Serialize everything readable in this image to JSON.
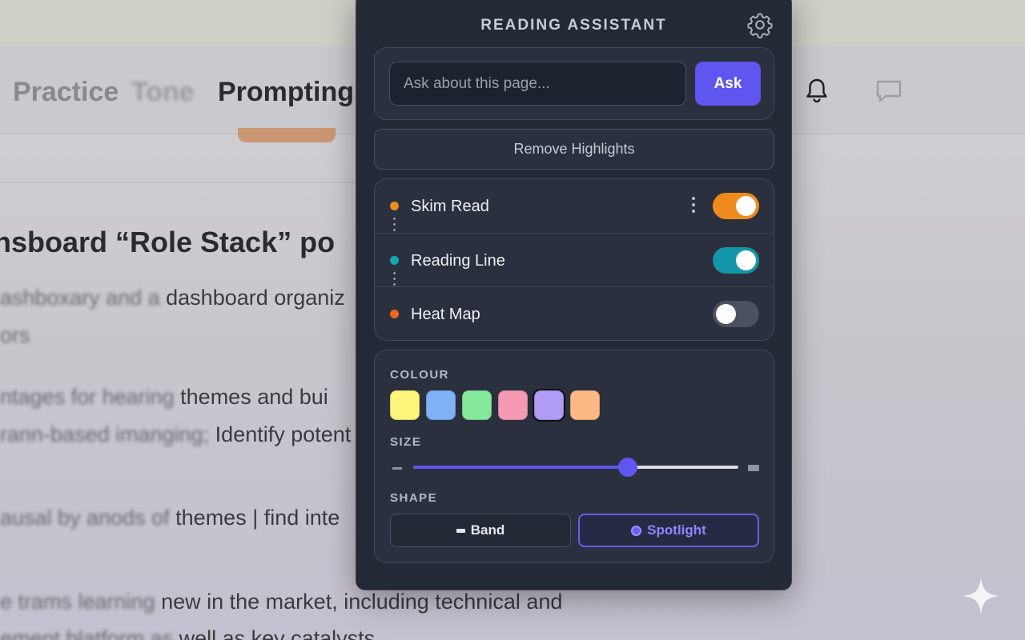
{
  "background": {
    "tabs": [
      {
        "label": "Practice"
      },
      {
        "label": "Tone"
      },
      {
        "label": "Prompting"
      }
    ],
    "heading": "hsboard “Role Stack” po",
    "paragraphs": [
      {
        "blurred": "ashboxary and a",
        "clear": " dashboard organiz"
      },
      {
        "blurred": "ors",
        "clear": ""
      },
      {
        "blurred": "ntages for hearing",
        "clear": " themes and bui"
      },
      {
        "blurred": "rann-based imanging;",
        "clear": " Identify potent"
      },
      {
        "blurred": "ausal by anods of",
        "clear": " themes | find inte"
      },
      {
        "blurred": "e trams learning",
        "clear": " new in the market, including technical and"
      },
      {
        "blurred": "ement blatform as",
        "clear": " well as key catalysts"
      }
    ]
  },
  "panel": {
    "title": "READING ASSISTANT",
    "settings_icon": "gear-icon",
    "ask": {
      "placeholder": "Ask about this page...",
      "button_label": "Ask"
    },
    "remove_label": "Remove Highlights",
    "modes": [
      {
        "label": "Skim Read",
        "on": true,
        "color": "#ef8a1e",
        "dot": "#f08c1d",
        "has_menu": true
      },
      {
        "label": "Reading Line",
        "on": true,
        "color": "#1496aa",
        "dot": "#17a3b8",
        "has_menu": false
      },
      {
        "label": "Heat Map",
        "on": false,
        "color": "#4a5160",
        "dot": "#f0651f",
        "has_menu": false
      }
    ],
    "colour": {
      "label": "COLOUR",
      "swatches": [
        "#fdf57c",
        "#7fb1f5",
        "#86e89b",
        "#f49ab2",
        "#b09cf5",
        "#fcb983"
      ],
      "selected_index": 4
    },
    "size": {
      "label": "SIZE",
      "value": 0.66
    },
    "shape": {
      "label": "SHAPE",
      "band_label": "Band",
      "spotlight_label": "Spotlight",
      "selected": "spotlight"
    },
    "accent": "#6155f0"
  }
}
